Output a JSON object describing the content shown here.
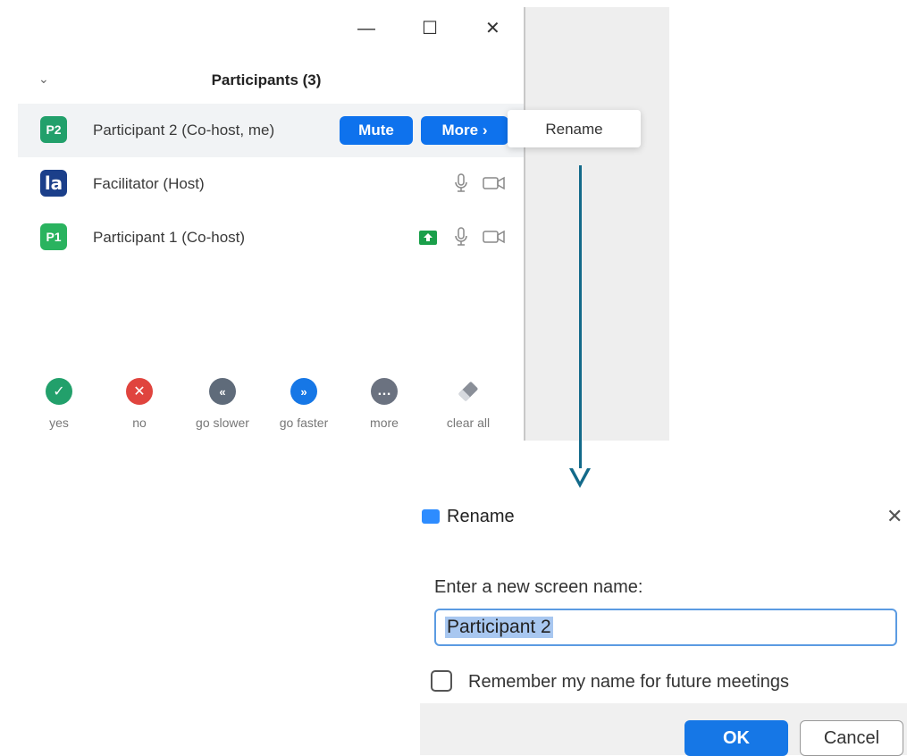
{
  "participants_panel": {
    "title": "Participants (3)",
    "window_controls": {
      "minimize": "—",
      "maximize": "☐",
      "close": "✕"
    },
    "rows": [
      {
        "avatar_text": "P2",
        "avatar_color": "#22a06b",
        "name": "Participant 2 (Co-host, me)",
        "mute_label": "Mute",
        "more_label": "More ›"
      },
      {
        "avatar_text": "la",
        "avatar_color": "#1b3f8a",
        "name": "Facilitator (Host)"
      },
      {
        "avatar_text": "P1",
        "avatar_color": "#2ab35f",
        "name": "Participant 1 (Co-host)"
      }
    ],
    "context_menu": {
      "item": "Rename"
    },
    "reactions": [
      {
        "icon": "check-icon",
        "label": "yes",
        "color": "#22a06b"
      },
      {
        "icon": "close-icon",
        "label": "no",
        "color": "#e0443e"
      },
      {
        "icon": "rewind-icon",
        "label": "go slower",
        "color": "#5f6b7a"
      },
      {
        "icon": "fast-forward-icon",
        "label": "go faster",
        "color": "#1677e6"
      },
      {
        "icon": "ellipsis-icon",
        "label": "more",
        "color": "#6b7280"
      },
      {
        "icon": "eraser-icon",
        "label": "clear all",
        "color": "#6b7280"
      }
    ]
  },
  "rename_dialog": {
    "title": "Rename",
    "prompt": "Enter a new screen name:",
    "input_value": "Participant 2",
    "checkbox_label": "Remember my name for future meetings",
    "checkbox_checked": false,
    "ok_label": "OK",
    "cancel_label": "Cancel"
  }
}
